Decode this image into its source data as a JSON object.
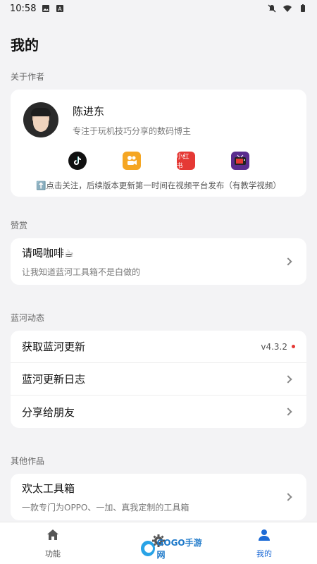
{
  "status": {
    "time": "10:58"
  },
  "page_title": "我的",
  "about": {
    "section_label": "关于作者",
    "name": "陈进东",
    "desc": "专注于玩机技巧分享的数码博主",
    "social": [
      "tiktok-icon",
      "kuaishou-icon",
      "xiaohongshu-icon",
      "video-tv-icon"
    ],
    "xhs_text": "小红书",
    "follow_tip": "⬆️点击关注，后续版本更新第一时间在视频平台发布（有教学视频）"
  },
  "donate": {
    "section_label": "赞赏",
    "title": "请喝咖啡☕",
    "sub": "让我知道蓝河工具箱不是白做的"
  },
  "dynamics": {
    "section_label": "蓝河动态",
    "items": [
      {
        "title": "获取蓝河更新",
        "version": "v4.3.2"
      },
      {
        "title": "蓝河更新日志"
      },
      {
        "title": "分享给朋友"
      }
    ]
  },
  "others": {
    "section_label": "其他作品",
    "title": "欢太工具箱",
    "sub": "一款专门为OPPO、一加、真我定制的工具箱"
  },
  "nav": {
    "items": [
      {
        "label": "功能"
      },
      {
        "label": ""
      },
      {
        "label": "我的"
      }
    ],
    "active_color": "#1e6bd6"
  },
  "watermark": {
    "text": "GOGO手游网"
  }
}
